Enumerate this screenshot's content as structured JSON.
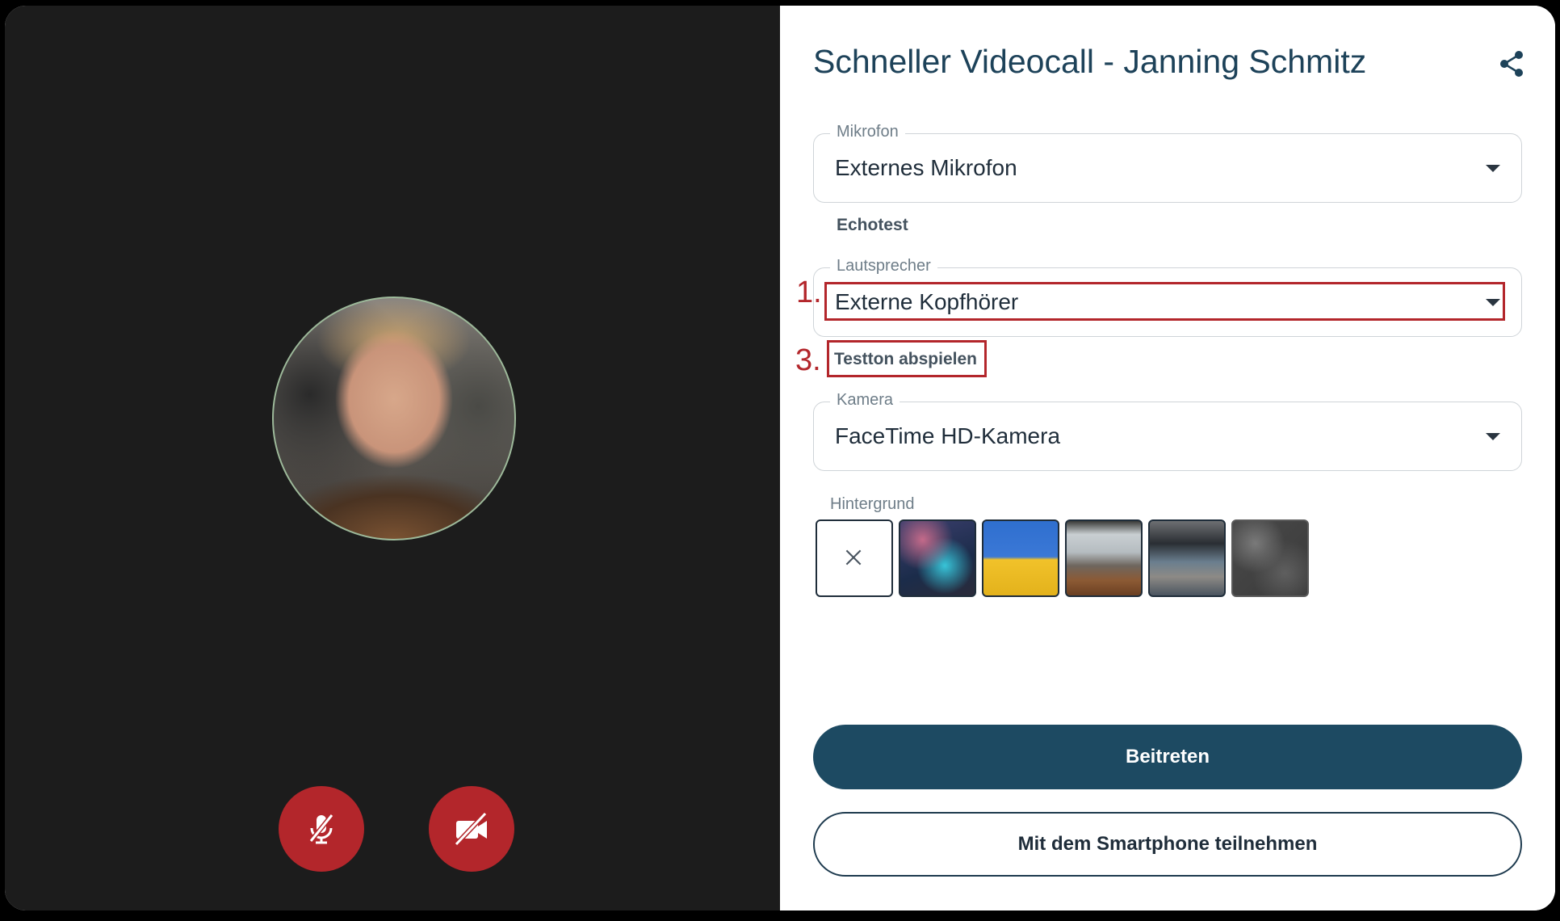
{
  "call": {
    "title": "Schneller Videocall - Janning Schmitz"
  },
  "microphone": {
    "label": "Mikrofon",
    "value": "Externes Mikrofon",
    "echotest_label": "Echotest"
  },
  "speaker": {
    "label": "Lautsprecher",
    "value": "Externe Kopfhörer",
    "test_tone_label": "Testton abspielen"
  },
  "camera": {
    "label": "Kamera",
    "value": "FaceTime HD-Kamera"
  },
  "background": {
    "label": "Hintergrund",
    "options": [
      "none",
      "blurred-blue",
      "blue-yellow-flag",
      "office-window",
      "modern-office",
      "dark-texture"
    ]
  },
  "annotations": {
    "first": "1.",
    "third": "3."
  },
  "buttons": {
    "join": "Beitreten",
    "smartphone": "Mit dem Smartphone teilnehmen"
  },
  "controls": {
    "mic_state": "muted",
    "camera_state": "off"
  },
  "colors": {
    "accent": "#1d4a62",
    "danger": "#b3262b",
    "title": "#1d4259"
  }
}
